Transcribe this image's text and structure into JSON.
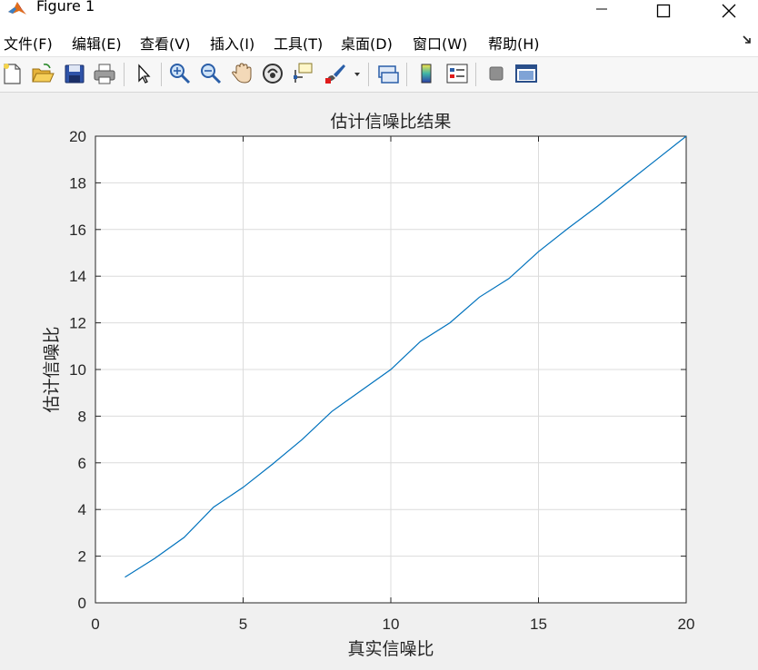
{
  "window": {
    "title": "Figure 1"
  },
  "menu": {
    "items": [
      {
        "label": "文件(F)"
      },
      {
        "label": "编辑(E)"
      },
      {
        "label": "查看(V)"
      },
      {
        "label": "插入(I)"
      },
      {
        "label": "工具(T)"
      },
      {
        "label": "桌面(D)"
      },
      {
        "label": "窗口(W)"
      },
      {
        "label": "帮助(H)"
      }
    ]
  },
  "toolbar": {
    "buttons": [
      {
        "icon": "new-figure-icon"
      },
      {
        "icon": "open-file-icon"
      },
      {
        "icon": "save-icon"
      },
      {
        "icon": "print-icon"
      },
      {
        "icon": "select-arrow-icon"
      },
      {
        "icon": "zoom-in-icon"
      },
      {
        "icon": "zoom-out-icon"
      },
      {
        "icon": "pan-hand-icon"
      },
      {
        "icon": "rotate-3d-icon"
      },
      {
        "icon": "data-cursor-icon"
      },
      {
        "icon": "brush-icon"
      },
      {
        "icon": "link-plot-icon"
      },
      {
        "icon": "colorbar-icon"
      },
      {
        "icon": "legend-icon"
      },
      {
        "icon": "hide-plot-tools-icon"
      },
      {
        "icon": "show-plot-tools-icon"
      }
    ]
  },
  "colors": {
    "line": "#0072bd",
    "grid": "#dcdcdc",
    "axes_bg": "#ffffff",
    "figure_bg": "#f0f0f0"
  },
  "chart_data": {
    "type": "line",
    "title": "估计信噪比结果",
    "xlabel": "真实信噪比",
    "ylabel": "估计信噪比",
    "xlim": [
      0,
      20
    ],
    "ylim": [
      0,
      20
    ],
    "xticks": [
      "0",
      "5",
      "10",
      "15",
      "20"
    ],
    "yticks": [
      "0",
      "2",
      "4",
      "6",
      "8",
      "10",
      "12",
      "14",
      "16",
      "18",
      "20"
    ],
    "grid": true,
    "x": [
      1,
      2,
      3,
      4,
      5,
      6,
      7,
      8,
      9,
      10,
      11,
      12,
      13,
      14,
      15,
      16,
      17,
      18,
      19,
      20
    ],
    "y": [
      1.1,
      1.9,
      2.8,
      4.1,
      4.95,
      5.95,
      7.0,
      8.2,
      9.1,
      10.0,
      11.2,
      12.0,
      13.1,
      13.9,
      15.05,
      16.05,
      17.0,
      18.0,
      19.0,
      20.0
    ]
  }
}
